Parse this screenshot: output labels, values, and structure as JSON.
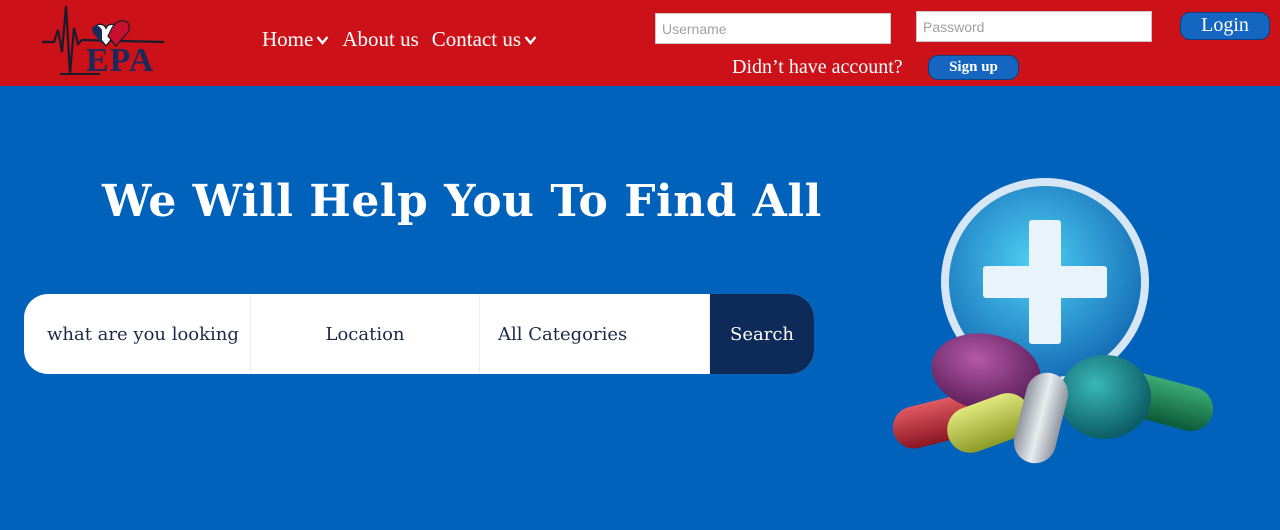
{
  "header": {
    "logo_text": "EPA",
    "nav": [
      {
        "label": "Home",
        "has_dropdown": true
      },
      {
        "label": "About us",
        "has_dropdown": false
      },
      {
        "label": "Contact us",
        "has_dropdown": true
      }
    ],
    "username_placeholder": "Username",
    "password_placeholder": "Password",
    "login_label": "Login",
    "no_account_text": "Didn’t have account?",
    "signup_label": "Sign up"
  },
  "hero": {
    "title": "We Will Help You To Find All",
    "search": {
      "query_text": "what are you looking",
      "location_text": "Location",
      "category_text": "All Categories",
      "button_label": "Search"
    }
  },
  "colors": {
    "header_bg": "#cc1218",
    "page_bg": "#0062bb",
    "button_blue": "#1566c0",
    "search_button": "#0d2a58"
  },
  "icons": {
    "logo": "heartbeat-heart-logo",
    "nav_dropdown": "chevron-down-icon",
    "hero_image": "medical-cross-pills-icon"
  }
}
